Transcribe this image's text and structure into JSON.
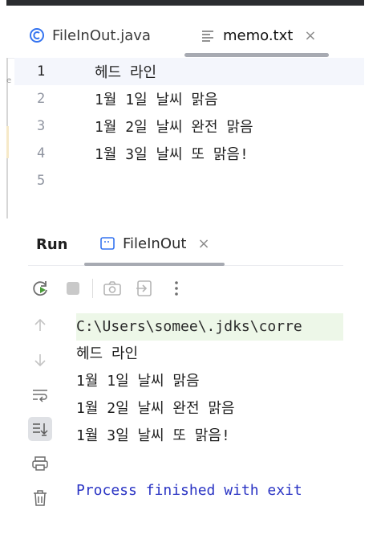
{
  "editor": {
    "tabs": [
      {
        "label": "FileInOut.java",
        "icon": "java-class-icon",
        "active": false
      },
      {
        "label": "memo.txt",
        "icon": "text-file-icon",
        "active": true,
        "close": "×"
      }
    ],
    "lines": [
      {
        "num": "1",
        "text": "헤드 라인"
      },
      {
        "num": "2",
        "text": "1월 1일 날씨 맑음"
      },
      {
        "num": "3",
        "text": "1월 2일 날씨 완전 맑음"
      },
      {
        "num": "4",
        "text": "1월 3일 날씨 또 맑음!"
      },
      {
        "num": "5",
        "text": ""
      }
    ],
    "edge_mark": "e"
  },
  "run": {
    "title": "Run",
    "tab_label": "FileInOut",
    "tab_close": "×",
    "console": {
      "command": "C:\\Users\\somee\\.jdks\\corre",
      "output": [
        "헤드 라인",
        "1월 1일 날씨 맑음",
        "1월 2일 날씨 완전 맑음",
        "1월 3일 날씨 또 맑음!"
      ],
      "exit": "Process finished with exit"
    }
  },
  "colors": {
    "accent_blue": "#3574f0",
    "exit_text": "#2a34c4",
    "command_bg": "#edf7e8"
  }
}
